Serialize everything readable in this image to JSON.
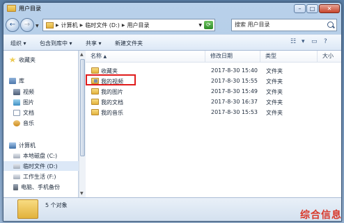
{
  "window": {
    "title": "用户目录"
  },
  "titlebar": {
    "minimize": "–",
    "maximize": "□",
    "close": "✕"
  },
  "address": {
    "crumbs": [
      "计算机",
      "临时文件 (D:)",
      "用户目录"
    ],
    "search_placeholder": "搜索 用户目录"
  },
  "toolbar": {
    "organize": "组织 ▾",
    "include_library": "包含到库中 ▾",
    "share": "共享 ▾",
    "new_folder": "新建文件夹"
  },
  "sidebar": {
    "items": [
      {
        "label": "收藏夹",
        "icon": "star-icon"
      },
      {
        "label": "库",
        "icon": "library-icon"
      },
      {
        "label": "视频",
        "icon": "video-icon"
      },
      {
        "label": "图片",
        "icon": "picture-icon"
      },
      {
        "label": "文档",
        "icon": "document-icon"
      },
      {
        "label": "音乐",
        "icon": "music-icon"
      },
      {
        "label": "计算机",
        "icon": "computer-icon"
      },
      {
        "label": "本地磁盘 (C:)",
        "icon": "disk-icon"
      },
      {
        "label": "临时文件 (D:)",
        "icon": "disk-icon"
      },
      {
        "label": "工作生活 (F:)",
        "icon": "disk-icon"
      },
      {
        "label": "电脑、手机备份",
        "icon": "disk-icon"
      }
    ]
  },
  "columns": {
    "name": "名称",
    "sort_indicator": "▲",
    "modified": "修改日期",
    "type": "类型",
    "size": "大小"
  },
  "files": [
    {
      "name": "收藏夹",
      "modified": "2017-8-30 15:40",
      "type": "文件夹"
    },
    {
      "name": "我的视频",
      "modified": "2017-8-30 15:55",
      "type": "文件夹"
    },
    {
      "name": "我的图片",
      "modified": "2017-8-30 15:49",
      "type": "文件夹"
    },
    {
      "name": "我的文档",
      "modified": "2017-8-30 16:37",
      "type": "文件夹"
    },
    {
      "name": "我的音乐",
      "modified": "2017-8-30 15:53",
      "type": "文件夹"
    }
  ],
  "status": {
    "count": "5 个对象"
  },
  "watermark": {
    "text": "综合信息"
  }
}
